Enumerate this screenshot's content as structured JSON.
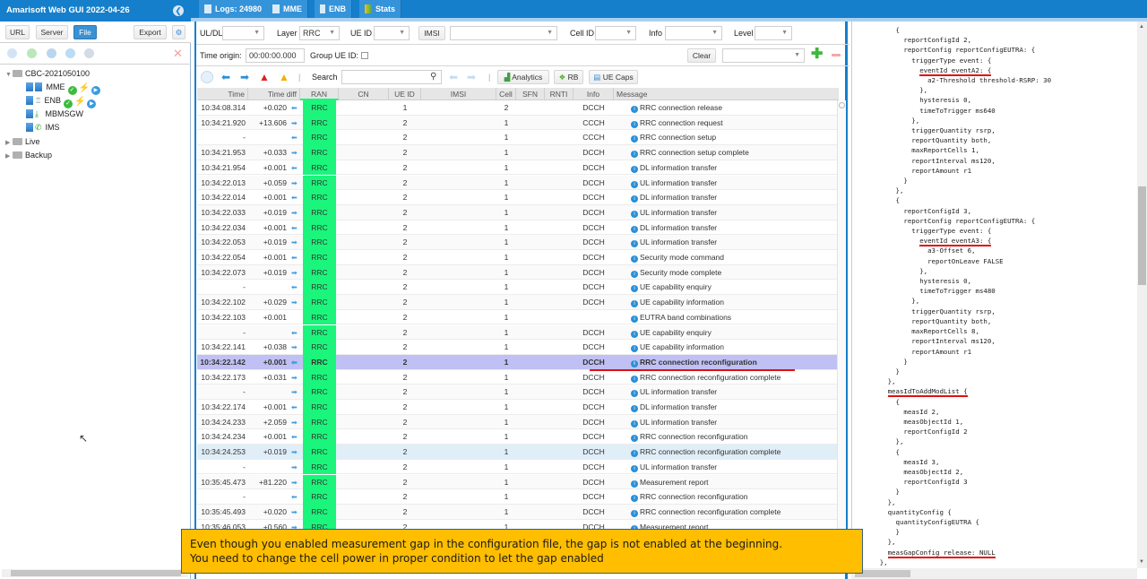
{
  "app": {
    "title": "Amarisoft Web GUI 2022-04-26"
  },
  "left_toolbar": {
    "url": "URL",
    "server": "Server",
    "file": "File",
    "export": "Export"
  },
  "tree": [
    {
      "label": "CBC-2021050100",
      "type": "folder",
      "expanded": true
    },
    {
      "label": "MME",
      "type": "server",
      "status": [
        "ok",
        "bolt",
        "play"
      ]
    },
    {
      "label": "ENB",
      "type": "server",
      "status": [
        "ok",
        "bolt",
        "play"
      ]
    },
    {
      "label": "MBMSGW",
      "type": "server"
    },
    {
      "label": "IMS",
      "type": "server"
    },
    {
      "label": "Live",
      "type": "folder",
      "expanded": false
    },
    {
      "label": "Backup",
      "type": "folder",
      "expanded": false
    }
  ],
  "tabs": [
    {
      "label": "Logs: 24980",
      "icon": "document-icon"
    },
    {
      "label": "MME",
      "icon": "server-icon"
    },
    {
      "label": "ENB",
      "icon": "antenna-icon"
    },
    {
      "label": "Stats",
      "icon": "chart-icon"
    }
  ],
  "filters": {
    "uldl_label": "UL/DL",
    "uldl_value": "",
    "layer_label": "Layer",
    "layer_value": "RRC",
    "ueid_label": "UE ID",
    "ueid_value": "",
    "imsi_button": "IMSI",
    "imsi_value": "",
    "cellid_label": "Cell ID",
    "cellid_value": "",
    "info_label": "Info",
    "info_value": "",
    "level_label": "Level",
    "level_value": "",
    "time_origin_label": "Time origin:",
    "time_origin_value": "00:00:00.000",
    "group_ueid_label": "Group UE ID:",
    "clear_button": "Clear"
  },
  "toolbar": {
    "search_label": "Search",
    "search_value": "",
    "analytics": "Analytics",
    "rb": "RB",
    "uecaps": "UE Caps"
  },
  "columns": [
    "Time",
    "Time diff",
    "RAN",
    "CN",
    "UE ID",
    "IMSI",
    "Cell",
    "SFN",
    "RNTI",
    "Info",
    "Message"
  ],
  "rows": [
    {
      "time": "10:34:08.314",
      "diff": "+0.020",
      "dir": "dl",
      "ran": "RRC",
      "ueid": "1",
      "cell": "2",
      "info": "DCCH",
      "msg": "RRC connection release"
    },
    {
      "time": "10:34:21.920",
      "diff": "+13.606",
      "dir": "ul",
      "ran": "RRC",
      "ueid": "2",
      "cell": "1",
      "info": "CCCH",
      "msg": "RRC connection request"
    },
    {
      "time": "-",
      "diff": "",
      "dir": "dl",
      "ran": "RRC",
      "ueid": "2",
      "cell": "1",
      "info": "CCCH",
      "msg": "RRC connection setup"
    },
    {
      "time": "10:34:21.953",
      "diff": "+0.033",
      "dir": "ul",
      "ran": "RRC",
      "ueid": "2",
      "cell": "1",
      "info": "DCCH",
      "msg": "RRC connection setup complete"
    },
    {
      "time": "10:34:21.954",
      "diff": "+0.001",
      "dir": "dl",
      "ran": "RRC",
      "ueid": "2",
      "cell": "1",
      "info": "DCCH",
      "msg": "DL information transfer"
    },
    {
      "time": "10:34:22.013",
      "diff": "+0.059",
      "dir": "ul",
      "ran": "RRC",
      "ueid": "2",
      "cell": "1",
      "info": "DCCH",
      "msg": "UL information transfer"
    },
    {
      "time": "10:34:22.014",
      "diff": "+0.001",
      "dir": "dl",
      "ran": "RRC",
      "ueid": "2",
      "cell": "1",
      "info": "DCCH",
      "msg": "DL information transfer"
    },
    {
      "time": "10:34:22.033",
      "diff": "+0.019",
      "dir": "ul",
      "ran": "RRC",
      "ueid": "2",
      "cell": "1",
      "info": "DCCH",
      "msg": "UL information transfer"
    },
    {
      "time": "10:34:22.034",
      "diff": "+0.001",
      "dir": "dl",
      "ran": "RRC",
      "ueid": "2",
      "cell": "1",
      "info": "DCCH",
      "msg": "DL information transfer"
    },
    {
      "time": "10:34:22.053",
      "diff": "+0.019",
      "dir": "ul",
      "ran": "RRC",
      "ueid": "2",
      "cell": "1",
      "info": "DCCH",
      "msg": "UL information transfer"
    },
    {
      "time": "10:34:22.054",
      "diff": "+0.001",
      "dir": "dl",
      "ran": "RRC",
      "ueid": "2",
      "cell": "1",
      "info": "DCCH",
      "msg": "Security mode command"
    },
    {
      "time": "10:34:22.073",
      "diff": "+0.019",
      "dir": "ul",
      "ran": "RRC",
      "ueid": "2",
      "cell": "1",
      "info": "DCCH",
      "msg": "Security mode complete"
    },
    {
      "time": "-",
      "diff": "",
      "dir": "dl",
      "ran": "RRC",
      "ueid": "2",
      "cell": "1",
      "info": "DCCH",
      "msg": "UE capability enquiry"
    },
    {
      "time": "10:34:22.102",
      "diff": "+0.029",
      "dir": "ul",
      "ran": "RRC",
      "ueid": "2",
      "cell": "1",
      "info": "DCCH",
      "msg": "UE capability information"
    },
    {
      "time": "10:34:22.103",
      "diff": "+0.001",
      "dir": "",
      "ran": "RRC",
      "ueid": "2",
      "cell": "1",
      "info": "",
      "msg": "EUTRA band combinations"
    },
    {
      "time": "-",
      "diff": "",
      "dir": "dl",
      "ran": "RRC",
      "ueid": "2",
      "cell": "1",
      "info": "DCCH",
      "msg": "UE capability enquiry"
    },
    {
      "time": "10:34:22.141",
      "diff": "+0.038",
      "dir": "ul",
      "ran": "RRC",
      "ueid": "2",
      "cell": "1",
      "info": "DCCH",
      "msg": "UE capability information"
    },
    {
      "time": "10:34:22.142",
      "diff": "+0.001",
      "dir": "dl",
      "ran": "RRC",
      "ueid": "2",
      "cell": "1",
      "info": "DCCH",
      "msg": "RRC connection reconfiguration",
      "selected": true
    },
    {
      "time": "10:34:22.173",
      "diff": "+0.031",
      "dir": "ul",
      "ran": "RRC",
      "ueid": "2",
      "cell": "1",
      "info": "DCCH",
      "msg": "RRC connection reconfiguration complete"
    },
    {
      "time": "-",
      "diff": "",
      "dir": "ul",
      "ran": "RRC",
      "ueid": "2",
      "cell": "1",
      "info": "DCCH",
      "msg": "UL information transfer"
    },
    {
      "time": "10:34:22.174",
      "diff": "+0.001",
      "dir": "dl",
      "ran": "RRC",
      "ueid": "2",
      "cell": "1",
      "info": "DCCH",
      "msg": "DL information transfer"
    },
    {
      "time": "10:34:24.233",
      "diff": "+2.059",
      "dir": "ul",
      "ran": "RRC",
      "ueid": "2",
      "cell": "1",
      "info": "DCCH",
      "msg": "UL information transfer"
    },
    {
      "time": "10:34:24.234",
      "diff": "+0.001",
      "dir": "dl",
      "ran": "RRC",
      "ueid": "2",
      "cell": "1",
      "info": "DCCH",
      "msg": "RRC connection reconfiguration"
    },
    {
      "time": "10:34:24.253",
      "diff": "+0.019",
      "dir": "ul",
      "ran": "RRC",
      "ueid": "2",
      "cell": "1",
      "info": "DCCH",
      "msg": "RRC connection reconfiguration complete",
      "hover": true
    },
    {
      "time": "-",
      "diff": "",
      "dir": "ul",
      "ran": "RRC",
      "ueid": "2",
      "cell": "1",
      "info": "DCCH",
      "msg": "UL information transfer"
    },
    {
      "time": "10:35:45.473",
      "diff": "+81.220",
      "dir": "ul",
      "ran": "RRC",
      "ueid": "2",
      "cell": "1",
      "info": "DCCH",
      "msg": "Measurement report"
    },
    {
      "time": "-",
      "diff": "",
      "dir": "dl",
      "ran": "RRC",
      "ueid": "2",
      "cell": "1",
      "info": "DCCH",
      "msg": "RRC connection reconfiguration"
    },
    {
      "time": "10:35:45.493",
      "diff": "+0.020",
      "dir": "ul",
      "ran": "RRC",
      "ueid": "2",
      "cell": "1",
      "info": "DCCH",
      "msg": "RRC connection reconfiguration complete"
    },
    {
      "time": "10:35:46.053",
      "diff": "+0.560",
      "dir": "ul",
      "ran": "RRC",
      "ueid": "2",
      "cell": "1",
      "info": "DCCH",
      "msg": "Measurement report"
    }
  ],
  "code_lines": [
    "          {",
    "            reportConfigId 2,",
    "            reportConfig reportConfigEUTRA: {",
    "              triggerType event: {",
    "                eventId eventA2: {",
    "                  a2-Threshold threshold-RSRP: 30",
    "                },",
    "                hysteresis 0,",
    "                timeToTrigger ms640",
    "              },",
    "              triggerQuantity rsrp,",
    "              reportQuantity both,",
    "              maxReportCells 1,",
    "              reportInterval ms120,",
    "              reportAmount r1",
    "            }",
    "          },",
    "          {",
    "            reportConfigId 3,",
    "            reportConfig reportConfigEUTRA: {",
    "              triggerType event: {",
    "                eventId eventA3: {",
    "                  a3-Offset 6,",
    "                  reportOnLeave FALSE",
    "                },",
    "                hysteresis 0,",
    "                timeToTrigger ms480",
    "              },",
    "              triggerQuantity rsrp,",
    "              reportQuantity both,",
    "              maxReportCells 8,",
    "              reportInterval ms120,",
    "              reportAmount r1",
    "            }",
    "          }",
    "        },",
    "        measIdToAddModList {",
    "          {",
    "            measId 2,",
    "            measObjectId 1,",
    "            reportConfigId 2",
    "          },",
    "          {",
    "            measId 3,",
    "            measObjectId 2,",
    "            reportConfigId 3",
    "          }",
    "        },",
    "        quantityConfig {",
    "          quantityConfigEUTRA {",
    "          }",
    "        },",
    "        measGapConfig release: NULL",
    "      },"
  ],
  "highlighted_code_lines": [
    4,
    21,
    36,
    52
  ],
  "annotation": {
    "line1": "Even though you enabled measurement gap in the configuration file, the gap is not enabled at the beginning.",
    "line2": "You need to change the cell power in proper condition to let the gap enabled"
  },
  "colors": {
    "brand": "#157fcc",
    "ran_green": "#1cf57c",
    "selected_row": "#c0c0f4",
    "note_bg": "#ffbe00",
    "underline_red": "#e01010"
  }
}
